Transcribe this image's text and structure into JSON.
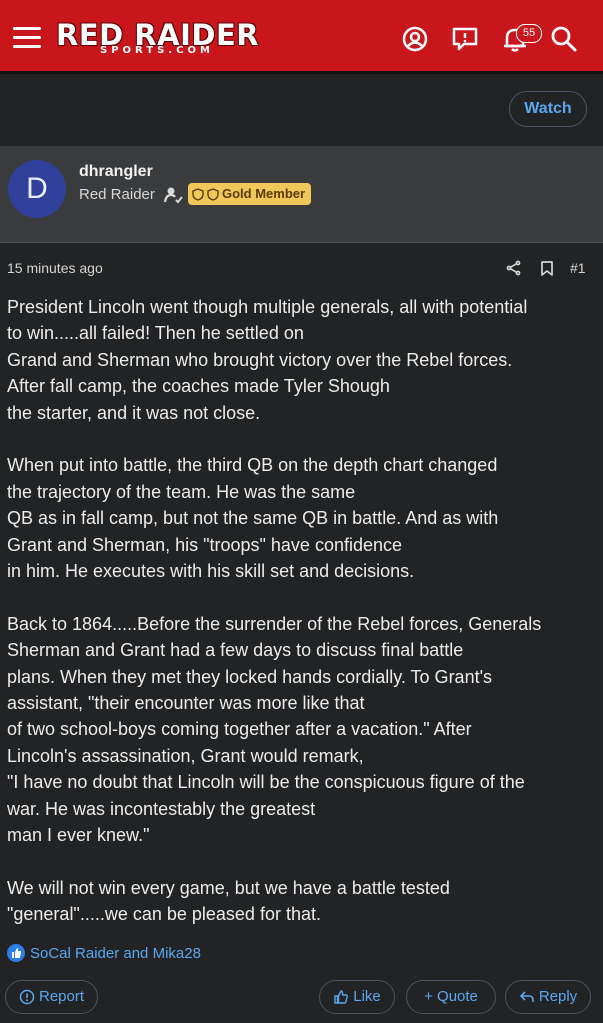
{
  "header": {
    "logo_main": "RED RAIDER",
    "logo_sub": "SPORTS.COM",
    "alerts_count": "55"
  },
  "thread": {
    "watch_label": "Watch"
  },
  "post": {
    "author": {
      "avatar_letter": "D",
      "username": "dhrangler",
      "title": "Red Raider",
      "badge": "Gold Member"
    },
    "time": "15 minutes ago",
    "number": "#1",
    "paragraphs": [
      "President Lincoln went though multiple generals, all with potential\nto win.....all failed! Then he settled on\nGrand and Sherman who brought victory over the Rebel forces.\nAfter fall camp, the coaches made Tyler Shough\nthe starter, and it was not close.",
      "When put into battle, the third QB on the depth chart changed\nthe trajectory of the team. He was the same\nQB as in fall camp, but not the same QB in battle. And as with\nGrant and Sherman, his \"troops\" have confidence\nin him. He executes with his skill set and decisions.",
      "Back to 1864.....Before the surrender of the Rebel forces, Generals\nSherman and Grant had a few days to discuss final battle\nplans. When they met they locked hands cordially. To Grant's\nassistant, \"their encounter was more like that\nof two school-boys coming together after a vacation.\" After\nLincoln's assassination, Grant would remark,\n\"I have no doubt that Lincoln will be the conspicuous figure of the\nwar. He was incontestably the greatest\nman I ever knew.\"",
      "We will not win every game, but we have a battle tested\n\"general\".....we can be pleased for that."
    ],
    "reactions": "SoCal Raider and Mika28"
  },
  "actions": {
    "report": "Report",
    "like": "Like",
    "quote": "+ Quote",
    "reply": "Reply"
  },
  "colors": {
    "brand_red": "#c8161c",
    "link_blue": "#5aa7ef",
    "gold_badge": "#f0c85a",
    "avatar_bg": "#2f3f9a"
  }
}
